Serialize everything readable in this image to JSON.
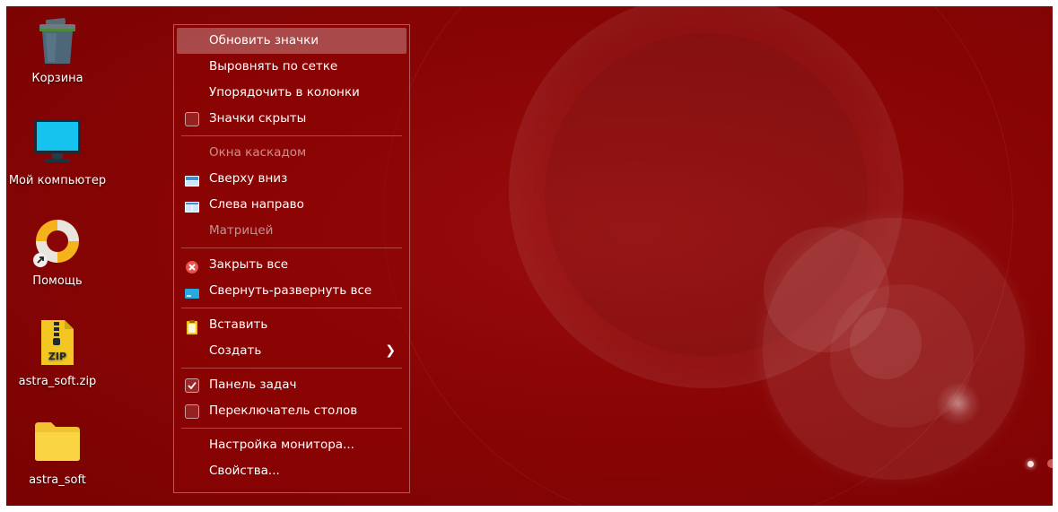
{
  "desktop_icons": [
    {
      "label": "Корзина",
      "icon": "trash-icon"
    },
    {
      "label": "Мой компьютер",
      "icon": "computer-icon"
    },
    {
      "label": "Помощь",
      "icon": "help-lifebuoy-icon"
    },
    {
      "label": "astra_soft.zip",
      "icon": "zip-archive-icon"
    },
    {
      "label": "astra_soft",
      "icon": "folder-icon"
    }
  ],
  "context_menu": {
    "group1": [
      {
        "label": "Обновить значки",
        "state": "highlighted"
      },
      {
        "label": "Выровнять по сетке"
      },
      {
        "label": "Упорядочить в колонки"
      },
      {
        "label": "Значки скрыты",
        "icon": "checkbox-unchecked-icon",
        "checked": false
      }
    ],
    "group2": [
      {
        "label": "Окна каскадом",
        "state": "disabled"
      },
      {
        "label": "Сверху вниз",
        "icon": "tile-horizontal-icon"
      },
      {
        "label": "Слева направо",
        "icon": "tile-vertical-icon"
      },
      {
        "label": "Матрицей",
        "state": "disabled"
      }
    ],
    "group3": [
      {
        "label": "Закрыть все",
        "icon": "close-all-icon"
      },
      {
        "label": "Свернуть-развернуть все",
        "icon": "minimize-all-icon"
      }
    ],
    "group4": [
      {
        "label": "Вставить",
        "icon": "paste-icon"
      },
      {
        "label": "Создать",
        "icon": "chevron-right-icon"
      }
    ],
    "group5": [
      {
        "label": "Панель задач",
        "icon": "checkbox-checked-icon",
        "checked": true
      },
      {
        "label": "Переключатель столов",
        "icon": "checkbox-unchecked-icon",
        "checked": false
      }
    ],
    "group6": [
      {
        "label": "Настройка монитора..."
      },
      {
        "label": "Свойства..."
      }
    ]
  },
  "colors": {
    "wallpaper": "#8a0505",
    "menu_highlight": "rgba(255,255,255,0.28)",
    "close_icon": "#e8534f",
    "tile_icon": "#cfe6fb",
    "minimize_icon": "#29a8e0",
    "paste_icon": "#f5c518"
  }
}
